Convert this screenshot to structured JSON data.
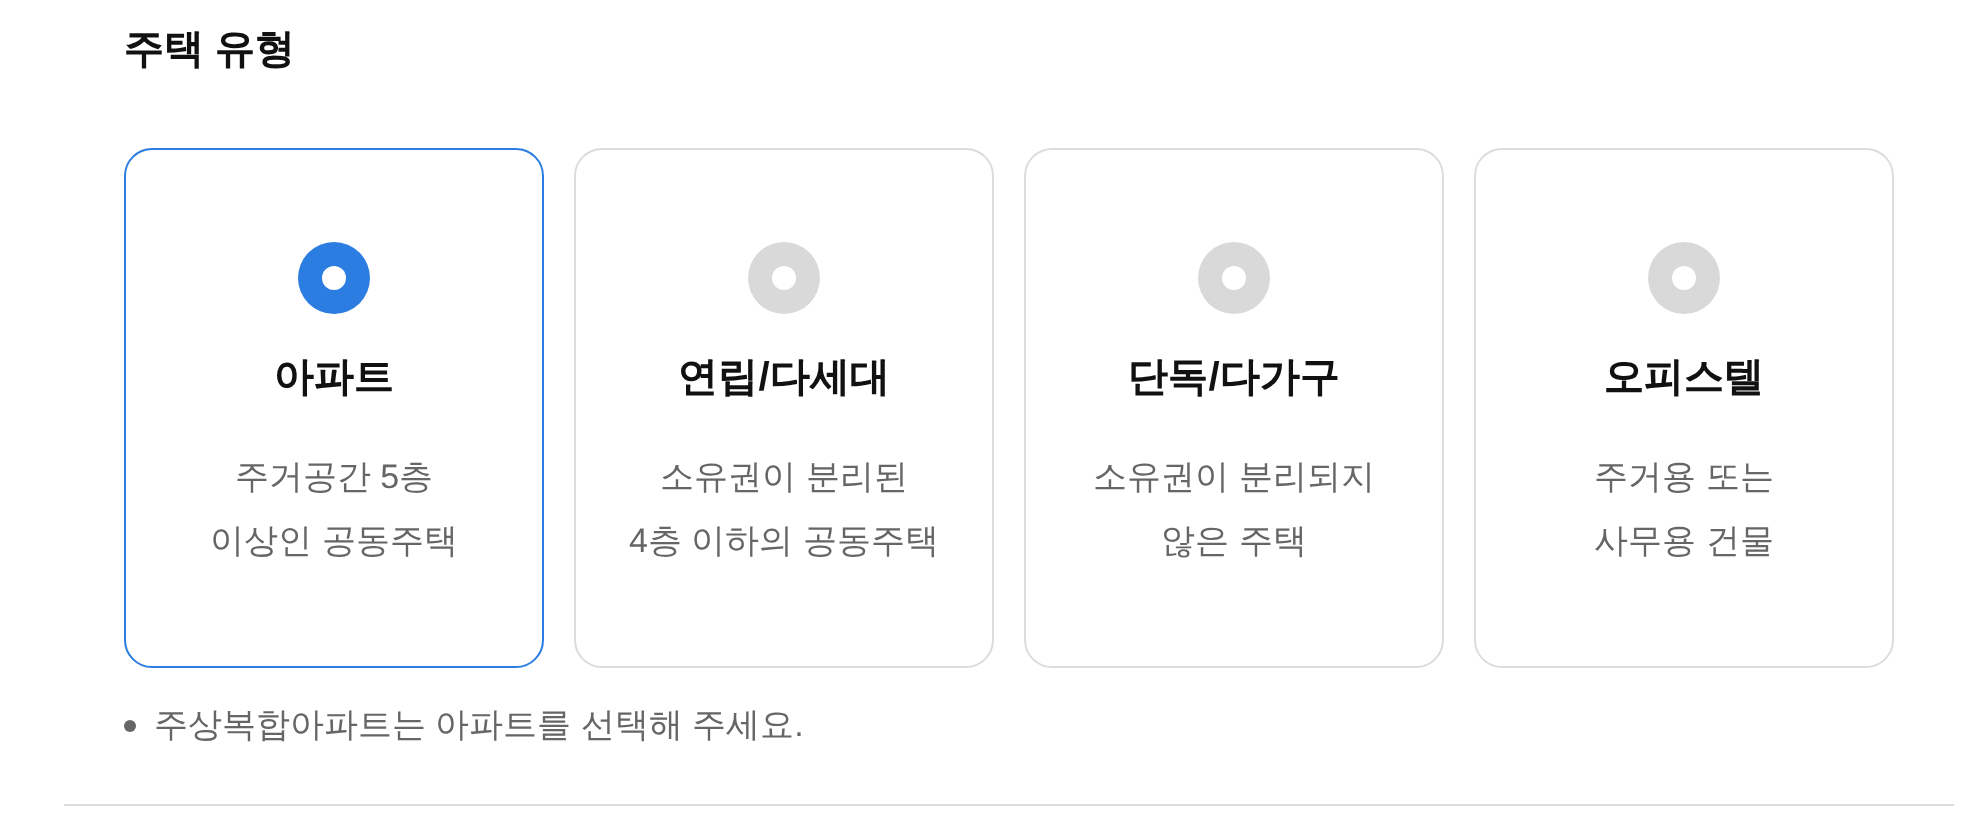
{
  "section_title": "주택 유형",
  "options": [
    {
      "label": "아파트",
      "description": [
        "주거공간 5층",
        "이상인 공동주택"
      ],
      "selected": true
    },
    {
      "label": "연립/다세대",
      "description": [
        "소유권이 분리된",
        "4층 이하의 공동주택"
      ],
      "selected": false
    },
    {
      "label": "단독/다가구",
      "description": [
        "소유권이 분리되지",
        "않은 주택"
      ],
      "selected": false
    },
    {
      "label": "오피스텔",
      "description": [
        "주거용 또는",
        "사무용 건물"
      ],
      "selected": false
    }
  ],
  "notes": [
    "주상복합아파트는 아파트를 선택해 주세요."
  ]
}
